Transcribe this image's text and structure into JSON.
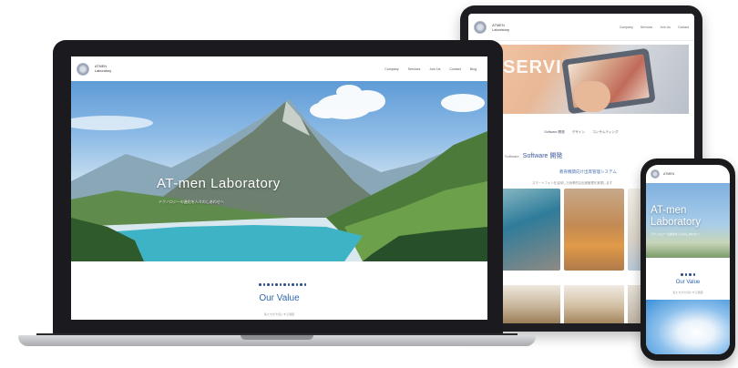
{
  "laptop": {
    "brand_line1": "ATMEN",
    "brand_line2": "Laboratory",
    "menu": [
      "Company",
      "Services",
      "Join Us",
      "Contact",
      "Blog"
    ],
    "hero_title": "AT-men Laboratory",
    "hero_tagline": "テクノロジーの進化を人々のしあわせへ",
    "section_title": "Our Value",
    "section_sub": "私たちが大切にする価値"
  },
  "tablet": {
    "brand_line1": "ATMEN",
    "brand_line2": "Laboratory",
    "menu": [
      "Company",
      "Services",
      "Join Us",
      "Contact"
    ],
    "hero_word": "SERVICES",
    "tabs": [
      "Software 開発",
      "デザイン",
      "コンサルティング"
    ],
    "section_title": "Software 開発",
    "section_small": "Software",
    "subheading": "教育機関向け出席管理システム",
    "description": "スマートフォンを活用した効率的な出席管理を実現します"
  },
  "phone": {
    "brand_line1": "ATMEN",
    "title_line1": "AT-men",
    "title_line2": "Laboratory",
    "tagline": "テクノロジーの進化を人々のしあわせへ",
    "section_title": "Our Value",
    "section_sub": "私たちが大切にする価値"
  },
  "colors": {
    "accent": "#2f66b0",
    "dark_blue": "#2d4f8e",
    "device_frame": "#1b1b1f"
  }
}
